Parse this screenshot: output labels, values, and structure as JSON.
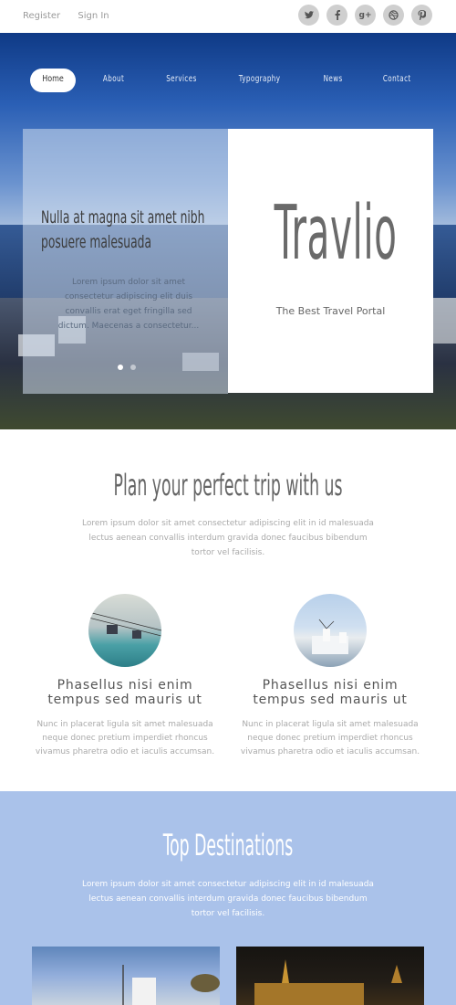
{
  "topbar": {
    "links": [
      "Register",
      "Sign In"
    ],
    "socials": [
      {
        "icon": "twitter-icon",
        "glyph": "t"
      },
      {
        "icon": "facebook-icon",
        "glyph": "f"
      },
      {
        "icon": "google-plus-icon",
        "glyph": "g+"
      },
      {
        "icon": "dribbble-icon",
        "glyph": "◎"
      },
      {
        "icon": "pinterest-icon",
        "glyph": "p"
      }
    ]
  },
  "nav": {
    "items": [
      "Home",
      "About",
      "Services",
      "Typography",
      "News",
      "Contact"
    ],
    "active": "Home"
  },
  "hero": {
    "slide_title": "Nulla at magna sit amet nibh posuere malesuada",
    "slide_text": "Lorem ipsum dolor sit amet consectetur adipiscing elit duis convallis erat eget fringilla sed dictum. Maecenas a consectetur...",
    "brand": "Travlio",
    "tagline": "The Best Travel Portal"
  },
  "plan": {
    "title": "Plan your perfect trip with us",
    "intro": "Lorem ipsum dolor sit amet consectetur adipiscing elit in id malesuada lectus aenean convallis interdum gravida donec faucibus bibendum tortor vel facilisis.",
    "features": [
      {
        "title": "Phasellus nisi enim tempus sed mauris ut",
        "text": "Nunc in placerat ligula sit amet malesuada neque donec pretium imperdiet rhoncus vivamus pharetra odio et iaculis accumsan."
      },
      {
        "title": "Phasellus nisi enim tempus sed mauris ut",
        "text": "Nunc in placerat ligula sit amet malesuada neque donec pretium imperdiet rhoncus vivamus pharetra odio et iaculis accumsan."
      }
    ]
  },
  "destinations": {
    "title": "Top Destinations",
    "intro": "Lorem ipsum dolor sit amet consectetur adipiscing elit in id malesuada lectus aenean convallis interdum gravida donec faucibus bibendum tortor vel facilisis."
  },
  "colors": {
    "accent_blue": "#aac2ea",
    "panel_white": "#ffffff",
    "text_gray": "#666666"
  }
}
